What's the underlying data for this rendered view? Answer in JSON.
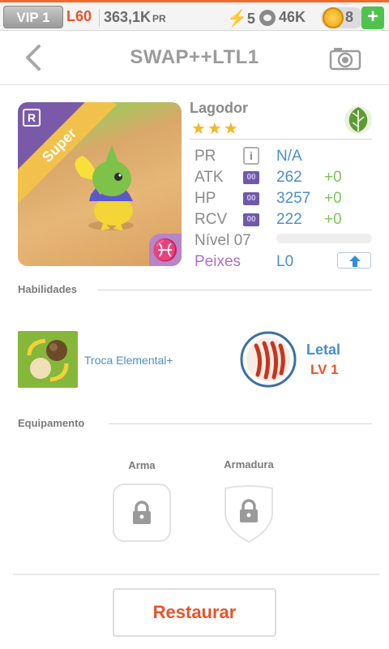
{
  "topbar": {
    "vip": "VIP 1",
    "level": "L60",
    "power": "363,1K",
    "power_unit": "PR",
    "energy": "5",
    "food": "46K",
    "coins": "8",
    "add_label": "+"
  },
  "header": {
    "title": "SWAP++LTL1"
  },
  "monster": {
    "rarity_letter": "R",
    "tier": "Super",
    "name": "Lagodor",
    "stars": "★★★",
    "element_icon": "leaf-icon",
    "zodiac_symbol": "♓",
    "stats": [
      {
        "label": "PR",
        "value": "N/A",
        "bonus": ""
      },
      {
        "label": "ATK",
        "value": "262",
        "bonus": "+0"
      },
      {
        "label": "HP",
        "value": "3257",
        "bonus": "+0"
      },
      {
        "label": "RCV",
        "value": "222",
        "bonus": "+0"
      }
    ],
    "stat_chip": "00",
    "stat_info": "i",
    "level_label": "Nível 07",
    "level_progress": 0,
    "fish_label": "Peixes",
    "fish_value": "L0"
  },
  "abilities": {
    "heading": "Habilidades",
    "items": [
      {
        "name": "Troca Elemental+",
        "icon": "element-swap-icon"
      },
      {
        "name": "Letal",
        "level": "LV 1",
        "icon": "claw-icon"
      }
    ]
  },
  "equipment": {
    "heading": "Equipamento",
    "weapon_label": "Arma",
    "armor_label": "Armadura"
  },
  "footer": {
    "restore_label": "Restaurar"
  },
  "colors": {
    "accent_orange": "#e8532a",
    "value_blue": "#4a8fc9",
    "bonus_green": "#7bc45c",
    "fish_purple": "#b16ec2"
  }
}
